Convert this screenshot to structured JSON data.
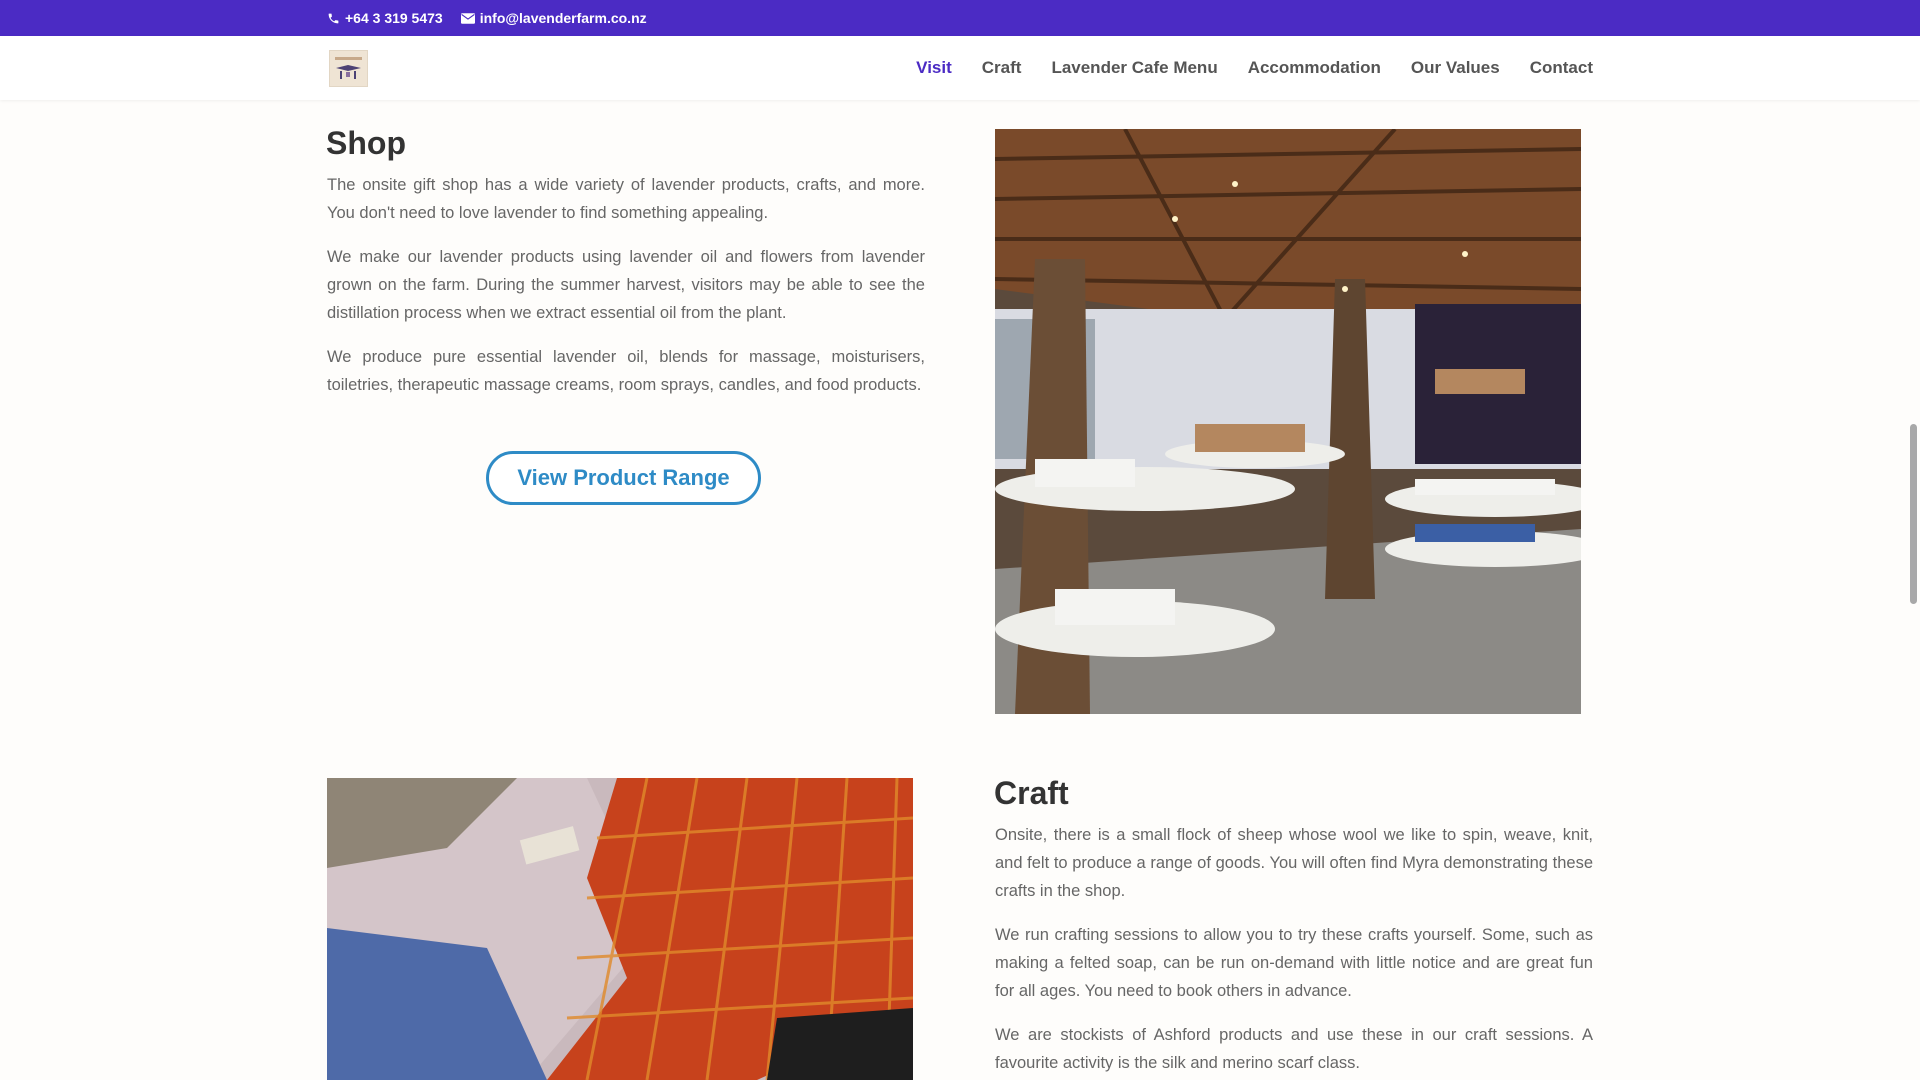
{
  "topbar": {
    "phone": "+64 3 319 5473",
    "email": "info@lavenderfarm.co.nz",
    "background": "#4b2bc4"
  },
  "nav": {
    "items": [
      {
        "label": "Visit",
        "active": true
      },
      {
        "label": "Craft"
      },
      {
        "label": "Lavender Cafe Menu"
      },
      {
        "label": "Accommodation"
      },
      {
        "label": "Our Values"
      },
      {
        "label": "Contact"
      }
    ]
  },
  "shop": {
    "title": "Shop",
    "paragraphs": [
      "The onsite gift shop has a wide variety of lavender products, crafts, and more. You don't need to love lavender to find something appealing.",
      "We make our lavender products using lavender oil and flowers from lavender grown on the farm. During the summer harvest, visitors may be able to see the distillation process when we extract essential oil from the plant.",
      "We produce pure essential lavender oil, blends for massage, moisturisers, toiletries, therapeutic massage creams, room sprays, candles, and food products."
    ],
    "button_label": "View Product Range",
    "button_color": "#2e8bc6"
  },
  "craft": {
    "title": "Craft",
    "paragraphs": [
      "Onsite, there is a small flock of sheep whose wool we like to spin, weave, knit, and felt to produce a range of goods. You will often find Myra demonstrating these crafts in the shop.",
      "We run crafting sessions to allow you to try these crafts yourself. Some, such as making a felted soap, can be run on-demand with little notice and are great fun for all ages. You need to book others in advance.",
      "We are stockists of Ashford products and use these in our craft sessions. A favourite activity is the silk and merino scarf class."
    ]
  }
}
